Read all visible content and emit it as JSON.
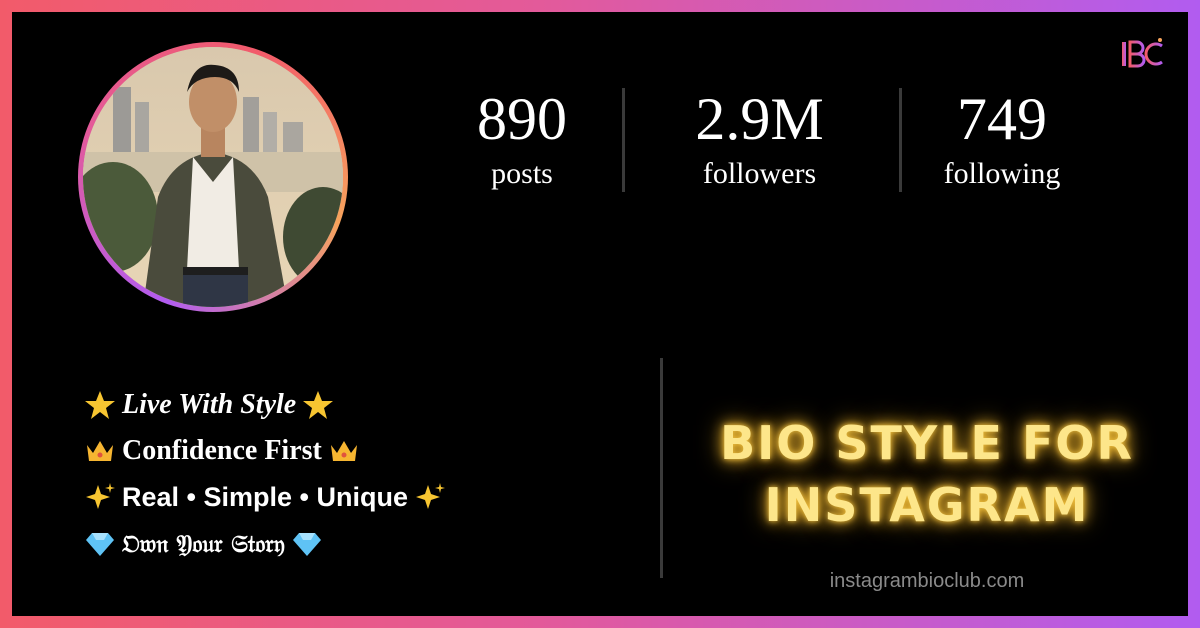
{
  "logo": {
    "text": "IBC",
    "accent": "#e35a9a"
  },
  "profile": {
    "avatar": "profile-photo",
    "stats": [
      {
        "value": "890",
        "label": "posts"
      },
      {
        "value": "2.9M",
        "label": "followers"
      },
      {
        "value": "749",
        "label": "following"
      }
    ]
  },
  "bio": {
    "lines": [
      {
        "emoji": "star-emoji",
        "text": "Live With Style"
      },
      {
        "emoji": "crown-emoji",
        "text": "Confidence First"
      },
      {
        "emoji": "sparkles-emoji",
        "text": "Real • Simple • Unique"
      },
      {
        "emoji": "gem-emoji",
        "text": "𝔒𝔴𝔫 𝔜𝔬𝔲𝔯 𝔖𝔱𝔬𝔯𝔶"
      }
    ]
  },
  "headline": {
    "line1": "BIO STYLE FOR",
    "line2": "INSTAGRAM",
    "color": "#fde68a"
  },
  "site": {
    "url": "instagrambioclub.com"
  },
  "colors": {
    "gradient_start": "#f25b6a",
    "gradient_end": "#b15cf0",
    "background": "#000000"
  }
}
